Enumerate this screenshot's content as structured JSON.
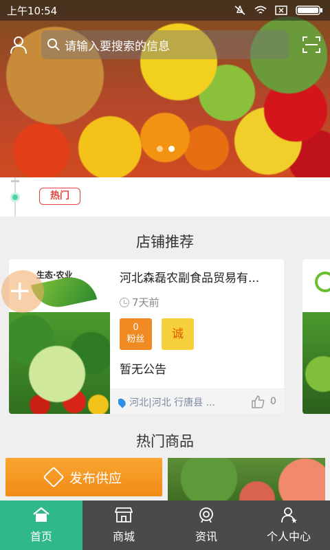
{
  "status_bar": {
    "time": "上午10:54",
    "icons": [
      "silent-icon",
      "wifi-icon",
      "close-box-icon",
      "battery-icon"
    ]
  },
  "banner": {
    "search_placeholder": "请输入要搜索的信息",
    "slide_count": 2,
    "active_slide": 1
  },
  "news": {
    "tag": "热门"
  },
  "sections": {
    "shops_title": "店铺推荐",
    "products_title": "热门商品"
  },
  "shop": {
    "logo_text": "生态·农业",
    "name": "河北森磊农副食品贸易有...",
    "time": "7天前",
    "fans_count": "0",
    "fans_label": "粉丝",
    "cheng_label": "诚",
    "notice": "暂无公告",
    "location": "河北|河北 行唐县 ...",
    "likes": "0"
  },
  "products": {
    "publish_label": "发布供应"
  },
  "bottom_nav": [
    {
      "label": "首页",
      "icon": "home-icon",
      "active": true
    },
    {
      "label": "商城",
      "icon": "store-icon",
      "active": false
    },
    {
      "label": "资讯",
      "icon": "news-icon",
      "active": false
    },
    {
      "label": "个人中心",
      "icon": "user-center-icon",
      "active": false
    }
  ],
  "colors": {
    "accent_green": "#2fb98a",
    "hot_red": "#e2433f",
    "orange": "#f08a23",
    "nav_bg": "#4a4a4a"
  }
}
